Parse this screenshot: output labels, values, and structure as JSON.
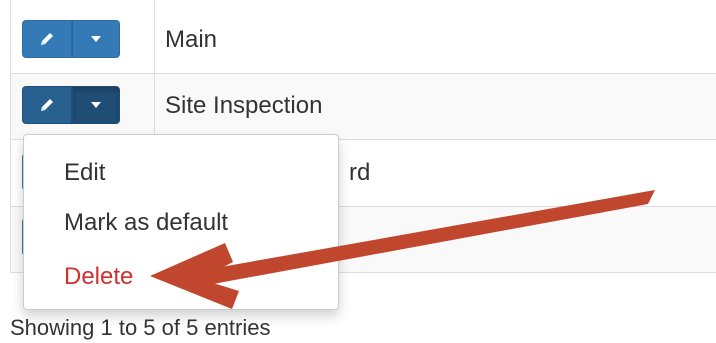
{
  "table": {
    "rows": [
      {
        "name": "Main"
      },
      {
        "name": "Site Inspection"
      },
      {
        "name_visible_fragment": "rd"
      }
    ]
  },
  "dropdown": {
    "items": [
      "Edit",
      "Mark as default",
      "Delete"
    ]
  },
  "footer": {
    "info": "Showing 1 to 5 of 5 entries"
  },
  "icons": {
    "edit": "pencil-icon",
    "toggle": "caret-down-icon"
  },
  "colors": {
    "primary_button": "#337ab7",
    "delete_text": "#d22e2e",
    "annotation_arrow": "#c0462e"
  }
}
